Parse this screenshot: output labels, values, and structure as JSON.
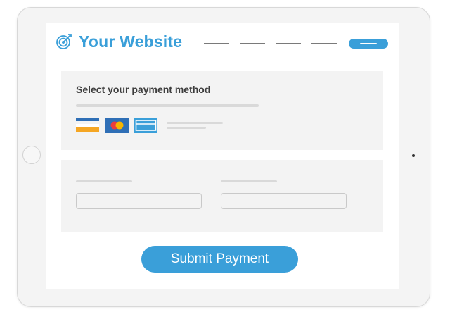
{
  "header": {
    "site_name": "Your Website",
    "logo_icon": "target-arrow-icon"
  },
  "payment": {
    "title": "Select your payment method",
    "methods": [
      {
        "icon": "generic-card-icon"
      },
      {
        "icon": "mastercard-icon"
      },
      {
        "icon": "card-outline-icon"
      }
    ]
  },
  "actions": {
    "submit_label": "Submit Payment"
  },
  "colors": {
    "accent": "#3a9fd9",
    "card_background": "#f3f3f3",
    "card_blue": "#2f6fb6",
    "card_orange": "#f5a623",
    "mastercard_red": "#eb3d3d",
    "mastercard_yellow": "#f7b500"
  }
}
